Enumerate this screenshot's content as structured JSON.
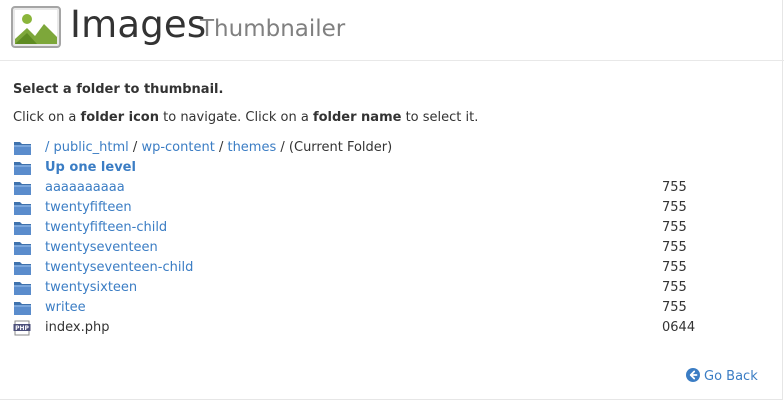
{
  "header": {
    "title": "Images",
    "subtitle": "Thumbnailer",
    "icon": "image-icon"
  },
  "instructions": {
    "heading": "Select a folder to thumbnail.",
    "part1": "Click on a ",
    "bold1": "folder icon",
    "part2": " to navigate. Click on a ",
    "bold2": "folder name",
    "part3": " to select it."
  },
  "breadcrumb": {
    "root": "/",
    "items": [
      "public_html",
      "wp-content",
      "themes"
    ],
    "separator": "/",
    "current": "(Current Folder)"
  },
  "up_level": "Up one level",
  "folders": [
    {
      "name": "aaaaaaaaaa",
      "perm": "755"
    },
    {
      "name": "twentyfifteen",
      "perm": "755"
    },
    {
      "name": "twentyfifteen-child",
      "perm": "755"
    },
    {
      "name": "twentyseventeen",
      "perm": "755"
    },
    {
      "name": "twentyseventeen-child",
      "perm": "755"
    },
    {
      "name": "twentysixteen",
      "perm": "755"
    },
    {
      "name": "writee",
      "perm": "755"
    }
  ],
  "files": [
    {
      "name": "index.php",
      "perm": "0644",
      "icon": "php-file-icon"
    }
  ],
  "go_back": "Go Back",
  "colors": {
    "link": "#3b7dc4",
    "text": "#333333",
    "subtitle": "#808080",
    "folder": "#4a7fc0"
  }
}
